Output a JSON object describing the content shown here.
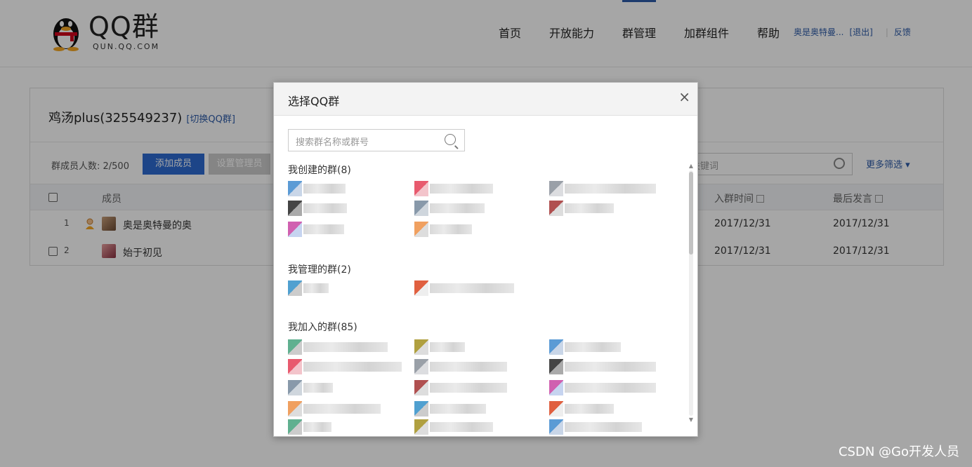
{
  "header": {
    "logo_text": "QQ群",
    "logo_sub": "QUN.QQ.COM",
    "nav": [
      "首页",
      "开放能力",
      "群管理",
      "加群组件",
      "帮助"
    ],
    "user_name": "奥是奥特曼...",
    "logout": "[退出]",
    "feedback": "反馈"
  },
  "panel": {
    "group_title": "鸡汤plus(325549237)",
    "switch_label": "[切换QQ群]",
    "member_count": "群成员人数: 2/500",
    "add_member": "添加成员",
    "set_admin": "设置管理员",
    "search_placeholder": "关键词",
    "more_filter": "更多筛选 ▾",
    "columns": {
      "member": "成员",
      "join_time": "入群时间",
      "last_speak": "最后发言"
    },
    "rows": [
      {
        "num": "1",
        "name": "奥是奥特曼的奥",
        "join": "2017/12/31",
        "last": "2017/12/31"
      },
      {
        "num": "2",
        "name": "始于初见",
        "join": "2017/12/31",
        "last": "2017/12/31"
      }
    ]
  },
  "modal": {
    "title": "选择QQ群",
    "close": "×",
    "search_placeholder": "搜索群名称或群号",
    "sections": {
      "created": "我创建的群(8)",
      "managed": "我管理的群(2)",
      "joined": "我加入的群(85)"
    }
  },
  "watermark": "CSDN @Go开发人员",
  "colors": {
    "primary": "#2d6bd2",
    "link": "#2d5ba8",
    "overlay": "rgba(0,0,0,0.35)"
  }
}
